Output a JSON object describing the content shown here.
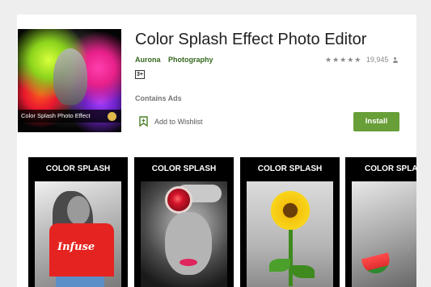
{
  "app": {
    "title": "Color Splash Effect Photo Editor",
    "developer": "Aurona",
    "category": "Photography",
    "rating_stars": "★★★★★",
    "rating_count": "19,945",
    "content_rating": "3+",
    "contains_ads": "Contains Ads",
    "wishlist_label": "Add to Wishlist",
    "install_label": "Install",
    "icon_caption": "Color Splash Photo Effect"
  },
  "screenshots": [
    {
      "title": "COLOR SPLASH",
      "shirt_text": "Infuse"
    },
    {
      "title": "COLOR SPLASH"
    },
    {
      "title": "COLOR SPLASH"
    },
    {
      "title": "COLOR SPLASH"
    }
  ],
  "icons": {
    "wishlist": "bookmark-add-icon",
    "rating_person": "person-icon",
    "next": "chevron-right-icon"
  },
  "colors": {
    "accent_green": "#689f38",
    "link_green": "#33691e"
  }
}
